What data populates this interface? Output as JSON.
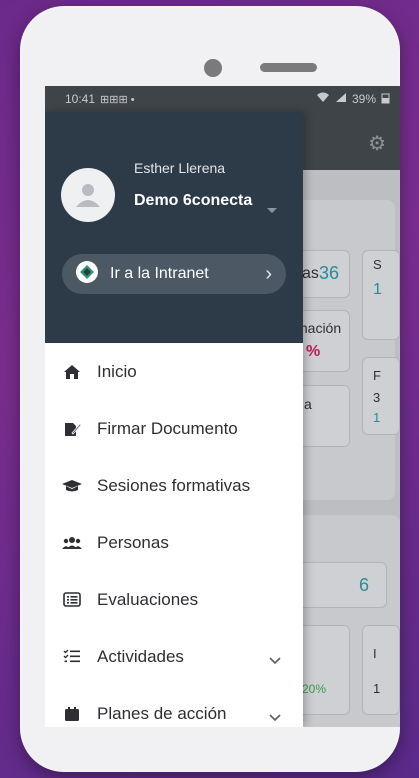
{
  "status_bar": {
    "time": "10:41",
    "notif_icons": "⊞⊞⊞ •",
    "battery": "39%"
  },
  "background": {
    "tile1_tail": "as",
    "tile1_value": "36",
    "tile2_label_fragment": "mación",
    "tile2_pct": "%",
    "tile3_fragment": "a",
    "tile4_value": "6",
    "tile5_pct": "↓20%",
    "right_fragment_1": "S",
    "right_fragment_2": "1",
    "right_fragment_3": "F",
    "right_fragment_4": "3",
    "right_fragment_5": "1",
    "right_fragment_6": "I",
    "right_fragment_7": "1"
  },
  "drawer": {
    "user_name": "Esther Llerena",
    "company": "Demo 6conecta",
    "intranet_label": "Ir a la Intranet",
    "menu": [
      {
        "label": "Inicio",
        "icon": "home-icon"
      },
      {
        "label": "Firmar Documento",
        "icon": "sign-document-icon"
      },
      {
        "label": "Sesiones formativas",
        "icon": "graduation-cap-icon"
      },
      {
        "label": "Personas",
        "icon": "users-icon"
      },
      {
        "label": "Evaluaciones",
        "icon": "list-card-icon"
      },
      {
        "label": "Actividades",
        "icon": "checklist-icon"
      },
      {
        "label": "Planes de acción",
        "icon": "calendar-icon"
      }
    ]
  },
  "colors": {
    "drawer_header": "#2d3b48",
    "accent_teal": "#2a8a9a",
    "accent_pink": "#c2185b"
  }
}
